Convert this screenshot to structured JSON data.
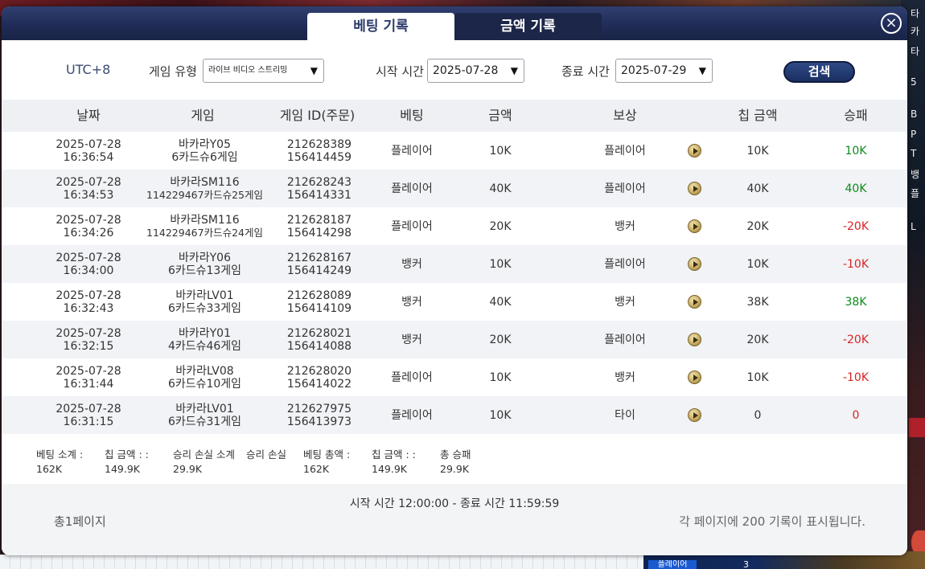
{
  "background": {
    "right_items": [
      "타",
      "카",
      "타",
      "5",
      "B",
      "P",
      "T",
      "뱅",
      "플",
      "L"
    ],
    "bottom_button": "플레이어",
    "bottom_number": "3"
  },
  "dialog": {
    "tabs": [
      {
        "label": "베팅 기록",
        "active": true
      },
      {
        "label": "금액 기록",
        "active": false
      }
    ],
    "close_label": "⨯"
  },
  "filters": {
    "timezone": "UTC+8",
    "game_type_label": "게임 유형",
    "game_type_value": "라이브 비디오 스트리밍",
    "start_label": "시작 시간",
    "start_value": "2025-07-28",
    "end_label": "종료 시간",
    "end_value": "2025-07-29",
    "search_label": "검색"
  },
  "table": {
    "headers": [
      "날짜",
      "게임",
      "게임 ID(주문)",
      "베팅",
      "금액",
      "보상",
      "칩 금액",
      "승패"
    ],
    "rows": [
      {
        "date": "2025-07-28",
        "time": "16:36:54",
        "game1": "바카라Y05",
        "game2": "6카드슈6게임",
        "id1": "212628389",
        "id2": "156414459",
        "bet": "플레이어",
        "amount": "10K",
        "result": "플레이어",
        "chip": "10K",
        "winloss": "10K",
        "outcome": "win"
      },
      {
        "date": "2025-07-28",
        "time": "16:34:53",
        "game1": "바카라SM116",
        "game2": "114229467카드슈25게임",
        "id1": "212628243",
        "id2": "156414331",
        "bet": "플레이어",
        "amount": "40K",
        "result": "플레이어",
        "chip": "40K",
        "winloss": "40K",
        "outcome": "win"
      },
      {
        "date": "2025-07-28",
        "time": "16:34:26",
        "game1": "바카라SM116",
        "game2": "114229467카드슈24게임",
        "id1": "212628187",
        "id2": "156414298",
        "bet": "플레이어",
        "amount": "20K",
        "result": "뱅커",
        "chip": "20K",
        "winloss": "-20K",
        "outcome": "loss"
      },
      {
        "date": "2025-07-28",
        "time": "16:34:00",
        "game1": "바카라Y06",
        "game2": "6카드슈13게임",
        "id1": "212628167",
        "id2": "156414249",
        "bet": "뱅커",
        "amount": "10K",
        "result": "플레이어",
        "chip": "10K",
        "winloss": "-10K",
        "outcome": "loss"
      },
      {
        "date": "2025-07-28",
        "time": "16:32:43",
        "game1": "바카라LV01",
        "game2": "6카드슈33게임",
        "id1": "212628089",
        "id2": "156414109",
        "bet": "뱅커",
        "amount": "40K",
        "result": "뱅커",
        "chip": "38K",
        "winloss": "38K",
        "outcome": "win"
      },
      {
        "date": "2025-07-28",
        "time": "16:32:15",
        "game1": "바카라Y01",
        "game2": "4카드슈46게임",
        "id1": "212628021",
        "id2": "156414088",
        "bet": "뱅커",
        "amount": "20K",
        "result": "플레이어",
        "chip": "20K",
        "winloss": "-20K",
        "outcome": "loss"
      },
      {
        "date": "2025-07-28",
        "time": "16:31:44",
        "game1": "바카라LV08",
        "game2": "6카드슈10게임",
        "id1": "212628020",
        "id2": "156414022",
        "bet": "플레이어",
        "amount": "10K",
        "result": "뱅커",
        "chip": "10K",
        "winloss": "-10K",
        "outcome": "loss"
      },
      {
        "date": "2025-07-28",
        "time": "16:31:15",
        "game1": "바카라LV01",
        "game2": "6카드슈31게임",
        "id1": "212627975",
        "id2": "156413973",
        "bet": "플레이어",
        "amount": "10K",
        "result": "타이",
        "chip": "0",
        "winloss": "0",
        "outcome": "loss"
      }
    ]
  },
  "summary": {
    "labels": [
      "베팅 소계 :",
      "칩 금액 : :",
      "승리 손실 소계",
      "승리 손실",
      "베팅 총액 :",
      "칩 금액 : :",
      "총 승패"
    ],
    "values": [
      "162K",
      "149.9K",
      "29.9K",
      "",
      "162K",
      "149.9K",
      "29.9K"
    ]
  },
  "footer": {
    "time_range": "시작 시간 12:00:00 - 종료 시간 11:59:59",
    "total_pages": "총1페이지",
    "per_page": "각 페이지에 200 기록이 표시됩니다."
  },
  "colors": {
    "header_bg": "#1f2b55",
    "win": "#0d8a1c",
    "loss": "#d92424",
    "search_btn": "#1a2f62"
  }
}
